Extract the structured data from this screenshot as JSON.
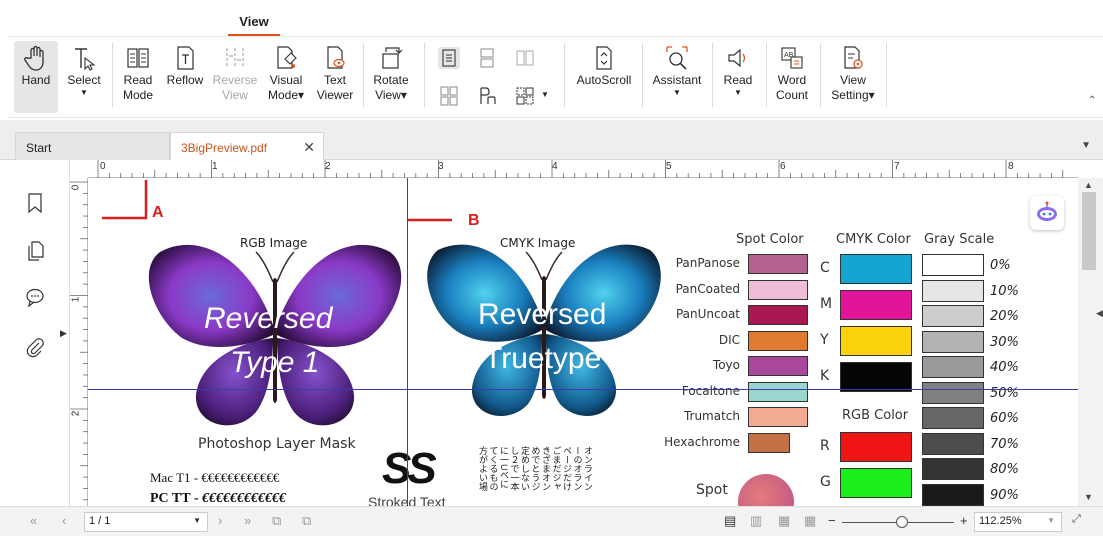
{
  "ribbon": {
    "active_tab": "View",
    "buttons": {
      "hand": "Hand",
      "select": "Select",
      "read_mode_1": "Read",
      "read_mode_2": "Mode",
      "reflow": "Reflow",
      "reverse_view_1": "Reverse",
      "reverse_view_2": "View",
      "visual_mode_1": "Visual",
      "visual_mode_2": "Mode",
      "text_viewer_1": "Text",
      "text_viewer_2": "Viewer",
      "rotate_view_1": "Rotate",
      "rotate_view_2": "View",
      "autoscroll": "AutoScroll",
      "assistant": "Assistant",
      "read": "Read",
      "word_count_1": "Word",
      "word_count_2": "Count",
      "view_setting_1": "View",
      "view_setting_2": "Setting"
    }
  },
  "tabs": {
    "start": "Start",
    "file": "3BigPreview.pdf"
  },
  "ruler": {
    "h_numbers": [
      "0",
      "1",
      "2",
      "3",
      "4",
      "5",
      "6",
      "7",
      "8"
    ],
    "v_numbers": [
      "0",
      "1",
      "2"
    ]
  },
  "page": {
    "marker_a": "A",
    "marker_b": "B",
    "rgb_image": "RGB Image",
    "cmyk_image": "CMYK Image",
    "reversed_type1_1": "Reversed",
    "reversed_type1_2": "Type 1",
    "reversed_truetype_1": "Reversed",
    "reversed_truetype_2": "Truetype",
    "photoshop_mask": "Photoshop Layer Mask",
    "mac_t1_label": "Mac T1 -",
    "mac_t1_chars": "€€€€€€€€€€€€",
    "pc_tt_label": "PC TT -",
    "pc_tt_chars": "€€€€€€€€€€€€",
    "ss_logo": "SS",
    "stroked_text": "Stroked Text",
    "spot": "Spot",
    "spot_color_title": "Spot Color",
    "cmyk_color_title": "CMYK Color",
    "gray_scale_title": "Gray Scale",
    "rgb_color_title": "RGB Color",
    "spot_rows": [
      {
        "label": "PanPanose",
        "color": "#b5628f"
      },
      {
        "label": "PanCoated",
        "color": "#ecbdd5"
      },
      {
        "label": "PanUncoat",
        "color": "#a8174f"
      },
      {
        "label": "DIC",
        "color": "#e07a2e"
      },
      {
        "label": "Toyo",
        "color": "#a9479a"
      },
      {
        "label": "Focaltone",
        "color": "#9ad6cd"
      },
      {
        "label": "Trumatch",
        "color": "#f5aa93"
      },
      {
        "label": "Hexachrome",
        "color": "#c47148"
      }
    ],
    "cmyk_rows": [
      {
        "label": "C",
        "color": "#13a4d2"
      },
      {
        "label": "M",
        "color": "#e3139a"
      },
      {
        "label": "Y",
        "color": "#fbd20c"
      },
      {
        "label": "K",
        "color": "#050505"
      }
    ],
    "rgb_rows": [
      {
        "label": "R",
        "color": "#f01515"
      },
      {
        "label": "G",
        "color": "#1bee1b"
      }
    ],
    "gray_rows": [
      {
        "label": "0%",
        "color": "#ffffff"
      },
      {
        "label": "10%",
        "color": "#e6e6e6"
      },
      {
        "label": "20%",
        "color": "#cccccc"
      },
      {
        "label": "30%",
        "color": "#b3b3b3"
      },
      {
        "label": "40%",
        "color": "#999999"
      },
      {
        "label": "50%",
        "color": "#808080"
      },
      {
        "label": "60%",
        "color": "#666666"
      },
      {
        "label": "70%",
        "color": "#4d4d4d"
      },
      {
        "label": "80%",
        "color": "#333333"
      },
      {
        "label": "90%",
        "color": "#1a1a1a"
      }
    ],
    "vertical_jp_cols": [
      "オンライン",
      "ーのオラン",
      "ページだけ",
      "ごまだジャ",
      "きざまオン",
      "めでとうジ",
      "定めしない",
      "し２で一本",
      "に一Uべに",
      "てくるもの",
      "方がよい場"
    ]
  },
  "statusbar": {
    "page": "1 / 1",
    "zoom": "112.25%"
  },
  "colors": {
    "accent": "#e0531f",
    "guide": "#3b3bb0",
    "marker": "#d62020"
  }
}
